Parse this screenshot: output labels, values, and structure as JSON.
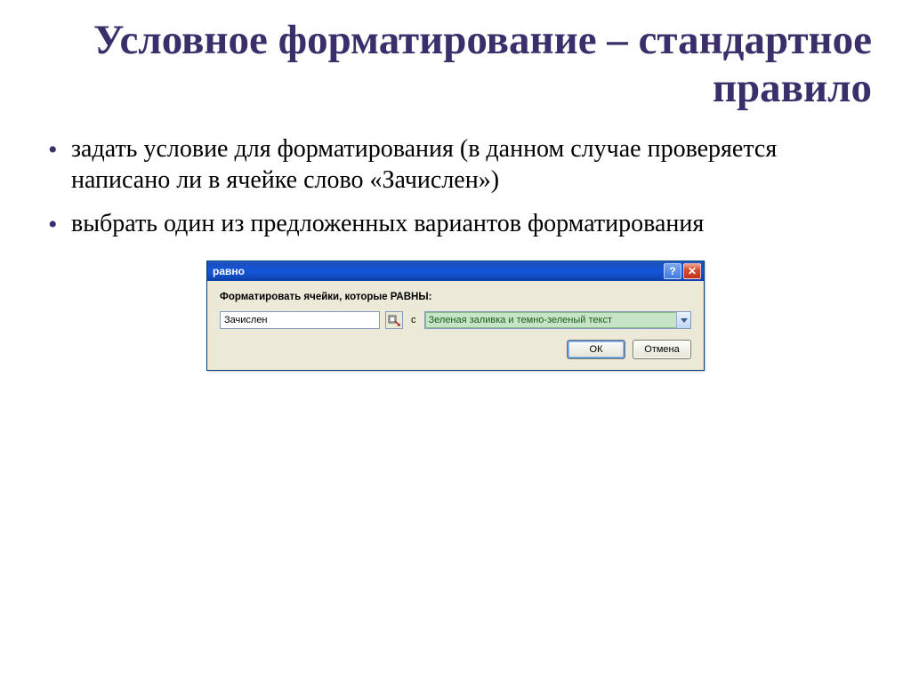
{
  "title": "Условное форматирование – стандартное правило",
  "bullets": [
    "задать условие для форматирования (в данном случае проверяется написано ли в ячейке слово «Зачислен»)",
    "выбрать один из предложенных вариантов форматирования"
  ],
  "dialog": {
    "title": "равно",
    "prompt": "Форматировать ячейки, которые РАВНЫ:",
    "value": "Зачислен",
    "with_label": "с",
    "format_option": "Зеленая заливка и темно-зеленый текст",
    "ok": "ОК",
    "cancel": "Отмена",
    "help": "?",
    "close": "✕"
  }
}
